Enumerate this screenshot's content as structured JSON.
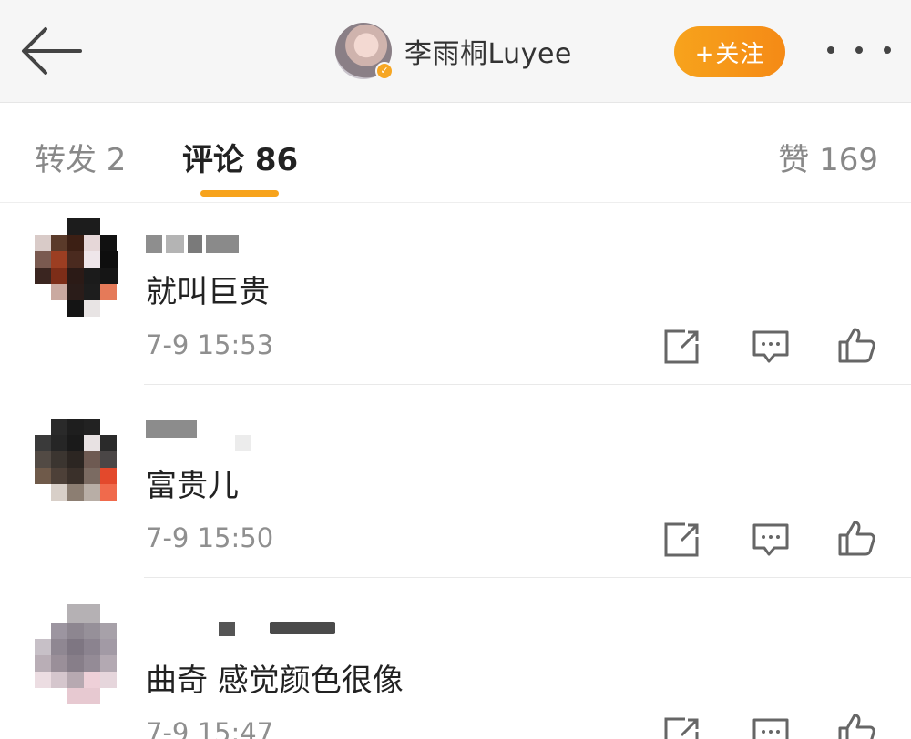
{
  "header": {
    "author_name": "李雨桐Luyee",
    "follow_label": "+关注"
  },
  "tabs": {
    "repost": "转发 2",
    "comments": "评论 86",
    "likes": "赞 169"
  },
  "comments": [
    {
      "text": "就叫巨贵",
      "time": "7-9 15:53"
    },
    {
      "text": "富贵儿",
      "time": "7-9 15:50"
    },
    {
      "text": "曲奇 感觉颜色很像",
      "time": "7-9 15:47"
    }
  ],
  "icons": {
    "back": "back-arrow-icon",
    "more": "more-dots-icon",
    "verified": "verified-badge-icon",
    "repost": "repost-icon",
    "reply": "comment-icon",
    "like": "like-icon"
  },
  "colors": {
    "accent": "#f7a31c"
  }
}
